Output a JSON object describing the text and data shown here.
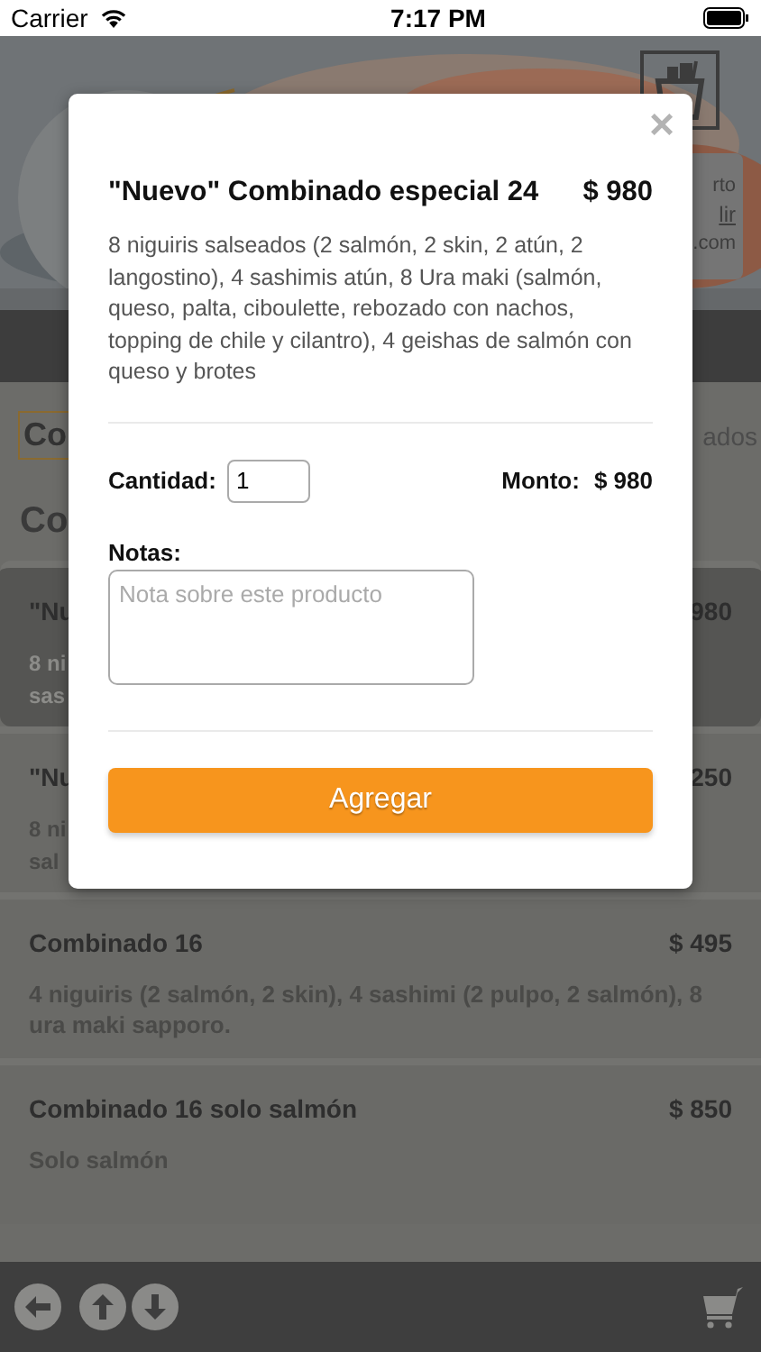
{
  "status_bar": {
    "carrier": "Carrier",
    "time": "7:17 PM"
  },
  "header": {
    "info_lines": [
      "rto",
      "lir",
      ".com"
    ]
  },
  "filters": {
    "category_value": "Co",
    "right_field_text": "ados"
  },
  "section_title": "Co",
  "products": [
    {
      "kind": "covered",
      "selected": true,
      "name": "\"Nu",
      "price": "980",
      "description_lines": [
        "8 ni",
        "sas"
      ]
    },
    {
      "kind": "covered",
      "selected": false,
      "name": "\"Nu",
      "price": "250",
      "description_lines": [
        "8 ni",
        "sal"
      ]
    },
    {
      "kind": "full",
      "selected": false,
      "name": "Combinado 16",
      "price": "$ 495",
      "description_lines": [
        "4 niguiris (2 salmón, 2 skin), 4 sashimi (2 pulpo, 2 salmón), 8 ura maki sapporo."
      ]
    },
    {
      "kind": "full",
      "selected": false,
      "name": "Combinado 16 solo salmón",
      "price": "$ 850",
      "description_lines": [
        "Solo salmón"
      ]
    }
  ],
  "toolbar": [
    {
      "kind": "back"
    },
    {
      "kind": "up"
    },
    {
      "kind": "down"
    },
    {
      "kind": "cart"
    }
  ],
  "modal": {
    "close": "×",
    "title": "\"Nuevo\" Combinado especial 24",
    "price": "$ 980",
    "description": "8 niguiris salseados (2 salmón, 2 skin, 2 atún, 2 langostino), 4 sashimis atún, 8 Ura maki (salmón, queso, palta, ciboulette, rebozado con nachos, topping de chile y cilantro), 4 geishas de salmón con queso y brotes",
    "quantity_label": "Cantidad:",
    "quantity_value": "1",
    "amount_label": "Monto:",
    "amount_value": "$ 980",
    "notes_label": "Notas:",
    "notes_placeholder": "Nota sobre este producto",
    "add_button": "Agregar"
  }
}
